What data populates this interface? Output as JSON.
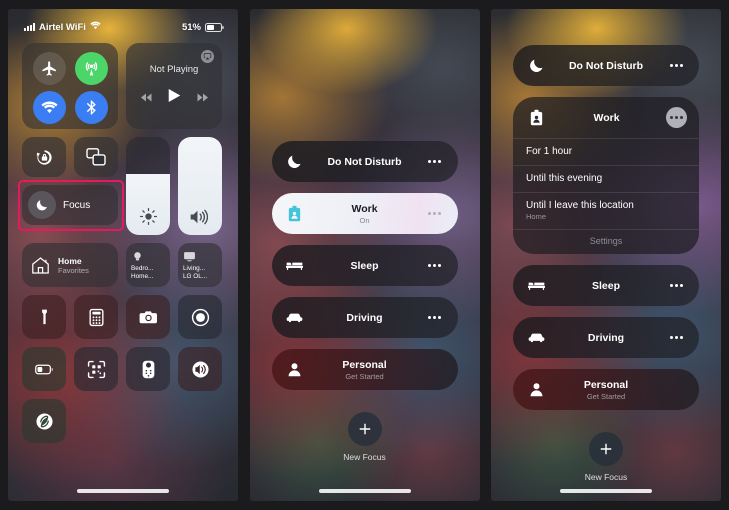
{
  "statusbar": {
    "carrier": "Airtel WiFi",
    "battery_percent": "51%",
    "signal_icon": "cellular-bars-icon",
    "wifi_icon": "wifi-icon",
    "battery_icon": "battery-icon"
  },
  "accent": {
    "highlight_border": "#e51a5e",
    "cellular_on": "#4cd569",
    "wifi_on": "#3b7ef4",
    "bluetooth_on": "#3b7ef4",
    "work_icon": "#43c4d8"
  },
  "control_center": {
    "connectivity": [
      {
        "name": "airplane-mode",
        "icon": "airplane-icon",
        "state": "off"
      },
      {
        "name": "cellular-data",
        "icon": "cellular-tower-icon",
        "state": "on"
      },
      {
        "name": "wifi",
        "icon": "wifi-icon",
        "state": "on"
      },
      {
        "name": "bluetooth",
        "icon": "bluetooth-icon",
        "state": "on"
      }
    ],
    "media": {
      "title": "Not Playing",
      "airplay_icon": "airplay-icon",
      "prev_icon": "rewind-icon",
      "play_icon": "play-icon",
      "next_icon": "fast-forward-icon"
    },
    "orientation_lock": {
      "label": "",
      "icon": "rotation-lock-icon"
    },
    "screen_mirroring": {
      "label": "",
      "icon": "screen-mirroring-icon"
    },
    "focus": {
      "label": "Focus",
      "icon": "moon-icon",
      "highlighted": true
    },
    "brightness": {
      "icon": "brightness-icon",
      "value": 60
    },
    "volume": {
      "icon": "volume-icon",
      "value": 100
    },
    "home": {
      "title": "Home",
      "subtitle": "Favorites",
      "icon": "home-icon",
      "accessories": [
        {
          "icon": "lightbulb-icon",
          "line1": "Bedro...",
          "line2": "Home..."
        },
        {
          "icon": "tv-icon",
          "line1": "Living...",
          "line2": "LG OL..."
        }
      ]
    },
    "tiles": [
      {
        "name": "flashlight",
        "icon": "flashlight-icon",
        "tone": "light"
      },
      {
        "name": "calculator",
        "icon": "calculator-icon",
        "tone": "light"
      },
      {
        "name": "camera",
        "icon": "camera-icon",
        "tone": "light"
      },
      {
        "name": "screen-record",
        "icon": "record-icon",
        "tone": "dark"
      },
      {
        "name": "low-power-mode",
        "icon": "battery-low-icon",
        "tone": "grn"
      },
      {
        "name": "code-scanner",
        "icon": "qr-scanner-icon",
        "tone": "dark"
      },
      {
        "name": "apple-tv-remote",
        "icon": "remote-icon",
        "tone": "dark"
      },
      {
        "name": "hearing",
        "icon": "hearing-icon",
        "tone": "light"
      },
      {
        "name": "shazam",
        "icon": "shazam-icon",
        "tone": "grn"
      }
    ]
  },
  "focus_panel": {
    "items": [
      {
        "title": "Do Not Disturb",
        "subtitle": "",
        "icon": "moon-icon",
        "active": false
      },
      {
        "title": "Work",
        "subtitle": "On",
        "icon": "badge-icon",
        "active": true
      },
      {
        "title": "Sleep",
        "subtitle": "",
        "icon": "bed-icon",
        "active": false
      },
      {
        "title": "Driving",
        "subtitle": "",
        "icon": "car-icon",
        "active": false
      },
      {
        "title": "Personal",
        "subtitle": "Get Started",
        "icon": "person-icon",
        "active": false
      }
    ],
    "new_focus": {
      "label": "New Focus",
      "icon": "plus-icon"
    }
  },
  "focus_expanded_panel": {
    "items_before": [
      {
        "title": "Do Not Disturb",
        "subtitle": "",
        "icon": "moon-icon"
      }
    ],
    "expanded": {
      "title": "Work",
      "icon": "badge-icon",
      "options": [
        {
          "label": "For 1 hour",
          "detail": ""
        },
        {
          "label": "Until this evening",
          "detail": ""
        },
        {
          "label": "Until I leave this location",
          "detail": "Home"
        }
      ],
      "settings_label": "Settings"
    },
    "items_after": [
      {
        "title": "Sleep",
        "subtitle": "",
        "icon": "bed-icon"
      },
      {
        "title": "Driving",
        "subtitle": "",
        "icon": "car-icon"
      },
      {
        "title": "Personal",
        "subtitle": "Get Started",
        "icon": "person-icon"
      }
    ],
    "new_focus": {
      "label": "New Focus",
      "icon": "plus-icon"
    }
  }
}
